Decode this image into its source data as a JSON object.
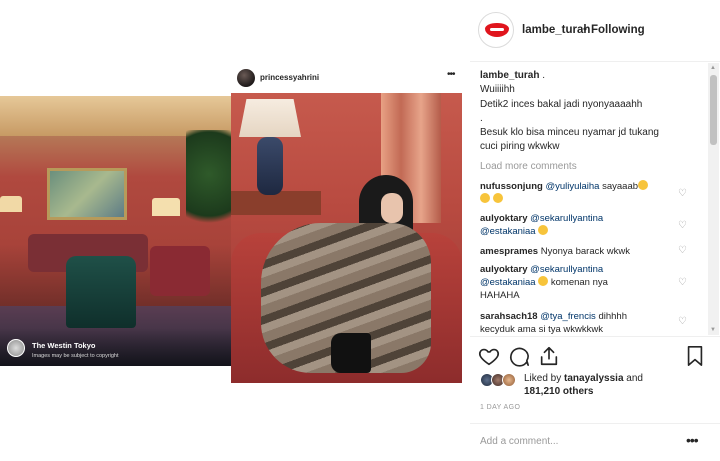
{
  "collage": {
    "left_photo": {
      "location_name": "The Westin Tokyo",
      "location_note": "Images may be subject to copyright"
    },
    "inner_post": {
      "username": "princessyahrini",
      "more_icon": "ellipsis-icon"
    }
  },
  "post": {
    "username": "lambe_turah",
    "separator": "•",
    "follow_status": "Following",
    "caption_user": "lambe_turah",
    "caption_user_suffix": ".",
    "caption_lines": [
      "Wuiiiihh",
      "Detik2 inces bakal jadi nyonyaaaahh",
      ".",
      "Besuk klo bisa minceu nyamar jd tukang",
      "cuci piring wkwkw"
    ],
    "load_more": "Load more comments",
    "comments": [
      {
        "user": "nufussonjung",
        "mention": "@yuliyulaiha",
        "text": " sayaaab"
      },
      {
        "user": "aulyoktary",
        "mention": "@sekarullyantina",
        "line2_mention": "@estakaniaa",
        "text": ""
      },
      {
        "user": "amesprames",
        "mention": "",
        "text": "Nyonya barack wkwk"
      },
      {
        "user": "aulyoktary",
        "mention": "@sekarullyantina",
        "line2_mention": "@estakaniaa",
        "text": " komenan nya",
        "line3": "HAHAHA"
      },
      {
        "user": "sarahsach18",
        "mention": "@tya_frencis",
        "text": " dihhhh",
        "line2": "kecyduk ama si tya wkwkkwk"
      }
    ],
    "likes": {
      "liked_by_prefix": "Liked by ",
      "liked_by_user": "tanayalyssia",
      "and": " and",
      "others_count": "181,210 others"
    },
    "time_ago": "1 DAY AGO",
    "add_comment_placeholder": "Add a comment...",
    "colors": {
      "text": "#262626",
      "muted": "#999999",
      "mention": "#003569",
      "border": "#efefef",
      "brand_red": "#e0151d"
    },
    "icons": [
      "heart-icon",
      "comment-icon",
      "share-icon",
      "bookmark-icon",
      "ellipsis-icon"
    ]
  }
}
